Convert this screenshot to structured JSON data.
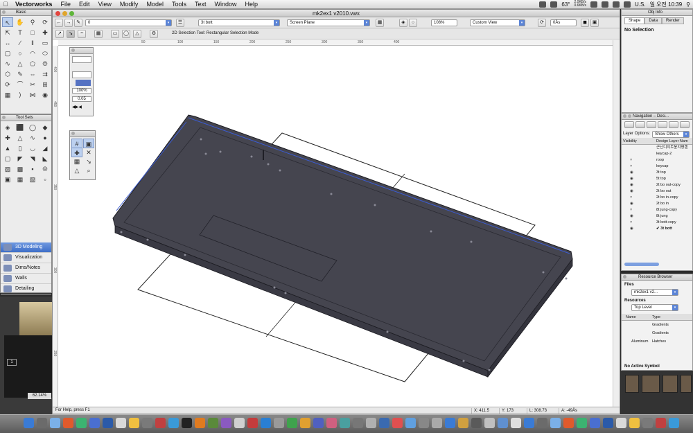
{
  "menubar": {
    "apple": "",
    "app_name": "Vectorworks",
    "items": [
      "File",
      "Edit",
      "View",
      "Modify",
      "Model",
      "Tools",
      "Text",
      "Window",
      "Help"
    ],
    "status": {
      "temperature": "63°",
      "net_up": "2.0KB/s",
      "net_down": "0.6KB/s",
      "input_lang": "U.S.",
      "clock": "일 오전 10:39"
    }
  },
  "document": {
    "title": "mk2ex1 v2010.vwx",
    "class_popup": "0",
    "layer_popup": "3t bott",
    "plane_popup": "Screen Plane",
    "zoom": "108%",
    "view_popup": "Custom View",
    "rotation": "0Ås",
    "tool_hint": "2D Selection Tool: Rectangular Selection Mode",
    "ruler_top": [
      "50",
      "100",
      "150",
      "200",
      "250",
      "300",
      "350",
      "400"
    ],
    "ruler_left": [
      "400",
      "450",
      "350",
      "300",
      "250"
    ]
  },
  "statusbar": {
    "help": "For Help, press F1",
    "x": "X:  411.5",
    "y": "Y:  173",
    "l": "L:  308.73",
    "a": "A:  -49Ås"
  },
  "palettes": {
    "basic_title": "Basic",
    "tool_sets_title": "Tool Sets",
    "tool_sets": [
      "3D Modeling",
      "Visualization",
      "Dims/Notes",
      "Walls",
      "Detailing"
    ],
    "attr_zoom": "100%",
    "attr_line": "0.05"
  },
  "obj_info": {
    "title": "Obj Info",
    "tabs": [
      "Shape",
      "Data",
      "Render"
    ],
    "selection": "No Selection"
  },
  "navigation": {
    "title": "Navigation – Desi...",
    "layer_options_label": "Layer Options:",
    "layer_options_value": "Show Others",
    "col_visibility": "Visibility",
    "col_name": "Design Layer Nam",
    "layers": [
      {
        "vis": "",
        "name": "근닌디지트윤지명렌"
      },
      {
        "vis": "",
        "name": "keycap-2"
      },
      {
        "vis": "×",
        "name": "roop"
      },
      {
        "vis": "×",
        "name": "keycap"
      },
      {
        "vis": "◉",
        "name": "3t top"
      },
      {
        "vis": "◉",
        "name": "5t top"
      },
      {
        "vis": "◉",
        "name": "2t bo out-copy"
      },
      {
        "vis": "◉",
        "name": "2t bo out"
      },
      {
        "vis": "×",
        "name": "2t bo in-copy"
      },
      {
        "vis": "◉",
        "name": "2t bo in"
      },
      {
        "vis": "×",
        "name": "8t jung-copy"
      },
      {
        "vis": "◉",
        "name": "8t jung"
      },
      {
        "vis": "×",
        "name": "3t bott-copy"
      },
      {
        "vis": "◉",
        "name": "3t bott",
        "active": true
      }
    ]
  },
  "resource_browser": {
    "title": "Resource Browser",
    "files_label": "Files",
    "files_value": "mk2ex1 v2...",
    "resources_label": "Resources",
    "resources_value": "Top Level",
    "col_name": "Name",
    "col_type": "Type",
    "rows": [
      {
        "name": "",
        "type": "Gradients"
      },
      {
        "name": "",
        "type": "Gradients"
      },
      {
        "name": "Aluminum",
        "type": "Hatches"
      }
    ],
    "footer": "No Active Symbol"
  },
  "desktop": {
    "zoom_label": "62.14%",
    "page_indicator": "1"
  }
}
